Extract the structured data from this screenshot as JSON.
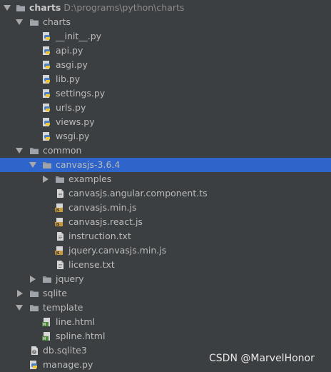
{
  "tree": {
    "root": {
      "name": "charts",
      "path": "D:\\programs\\python\\charts"
    },
    "charts_folder": {
      "name": "charts",
      "files": [
        "__init__.py",
        "api.py",
        "asgi.py",
        "lib.py",
        "settings.py",
        "urls.py",
        "views.py",
        "wsgi.py"
      ]
    },
    "common_folder": {
      "name": "common",
      "canvasjs": {
        "name": "canvasjs-3.6.4",
        "examples": "examples",
        "files": [
          "canvasjs.angular.component.ts",
          "canvasjs.min.js",
          "canvasjs.react.js",
          "instruction.txt",
          "jquery.canvasjs.min.js",
          "license.txt"
        ]
      },
      "jquery": "jquery"
    },
    "sqlite_folder": "sqlite",
    "template_folder": {
      "name": "template",
      "files": [
        "line.html",
        "spline.html"
      ]
    },
    "db_file": "db.sqlite3",
    "manage_file": "manage.py"
  },
  "watermark": "CSDN @MarvelHonor",
  "colors": {
    "background": "#3c3f41",
    "selection": "#2f65ca",
    "text": "#bbbbbb",
    "folder": "#8c9196",
    "python_blue": "#4a82c4",
    "python_yellow": "#f0c53c",
    "js_badge": "#c89b3c",
    "html_badge": "#4e8a3a"
  }
}
